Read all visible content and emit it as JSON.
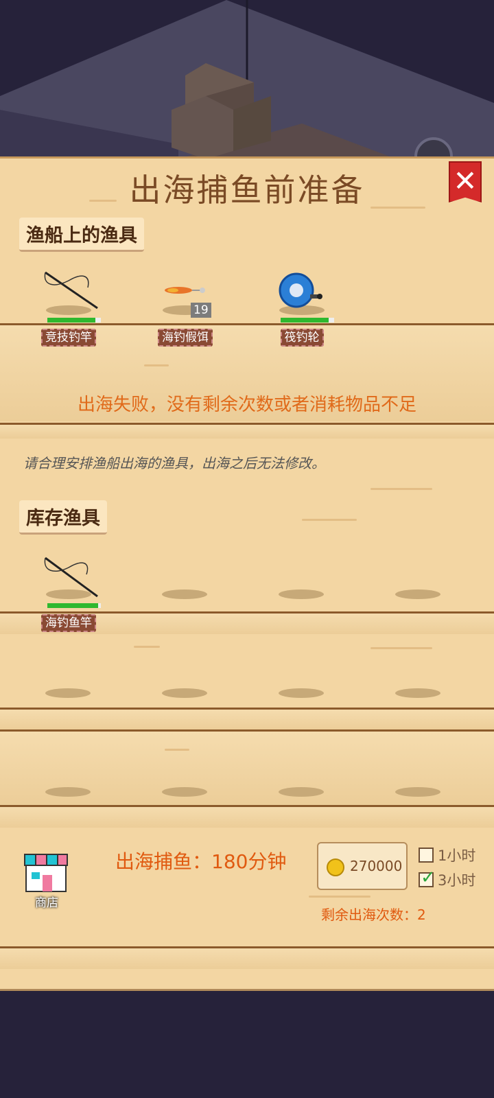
{
  "panel": {
    "title": "出海捕鱼前准备"
  },
  "boat_gear": {
    "title": "渔船上的渔具",
    "items": [
      {
        "name": "竞技钓竿",
        "durability_fraction": 0.9,
        "icon": "fishing-rod-icon"
      },
      {
        "name": "海钓假饵",
        "count": "19",
        "icon": "lure-icon"
      },
      {
        "name": "筏钓轮",
        "durability_fraction": 0.9,
        "icon": "fishing-reel-icon"
      }
    ]
  },
  "fail_message": "出海失败，没有剩余次数或者消耗物品不足",
  "tip": "请合理安排渔船出海的渔具，出海之后无法修改。",
  "inventory": {
    "title": "库存渔具",
    "items": [
      {
        "name": "海钓鱼竿",
        "durability_fraction": 0.95,
        "icon": "fishing-rod-icon"
      }
    ]
  },
  "footer": {
    "shop_label": "商店",
    "duration_text": "出海捕鱼：180分钟",
    "price": "270000",
    "options": [
      {
        "label": "1小时",
        "checked": false
      },
      {
        "label": "3小时",
        "checked": true
      }
    ],
    "remaining_text": "剩余出海次数：2"
  },
  "colors": {
    "accent_orange": "#e05a10",
    "title_brown": "#7a4a25",
    "close_red": "#d42a2a",
    "durability_green": "#2fb82f"
  }
}
